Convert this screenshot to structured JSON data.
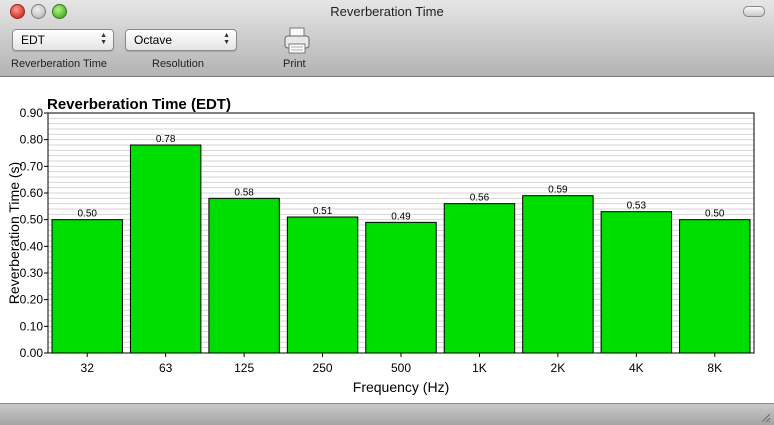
{
  "window": {
    "title": "Reverberation Time"
  },
  "toolbar": {
    "measure_select": {
      "value": "EDT",
      "label": "Reverberation Time"
    },
    "resolution_select": {
      "value": "Octave",
      "label": "Resolution"
    },
    "print": {
      "label": "Print",
      "icon": "printer-icon"
    }
  },
  "chart_data": {
    "type": "bar",
    "title": "Reverberation Time (EDT)",
    "xlabel": "Frequency (Hz)",
    "ylabel": "Reverberation Time (s)",
    "categories": [
      "32",
      "63",
      "125",
      "250",
      "500",
      "1K",
      "2K",
      "4K",
      "8K"
    ],
    "values": [
      0.5,
      0.78,
      0.58,
      0.51,
      0.49,
      0.56,
      0.59,
      0.53,
      0.5
    ],
    "value_labels": [
      "0.50",
      "0.78",
      "0.58",
      "0.51",
      "0.49",
      "0.56",
      "0.59",
      "0.53",
      "0.50"
    ],
    "ylim": [
      0,
      0.9
    ],
    "yticks": [
      "0.00",
      "0.10",
      "0.20",
      "0.30",
      "0.40",
      "0.50",
      "0.60",
      "0.70",
      "0.80",
      "0.90"
    ],
    "grid": true,
    "bar_color": "#00dd00"
  }
}
